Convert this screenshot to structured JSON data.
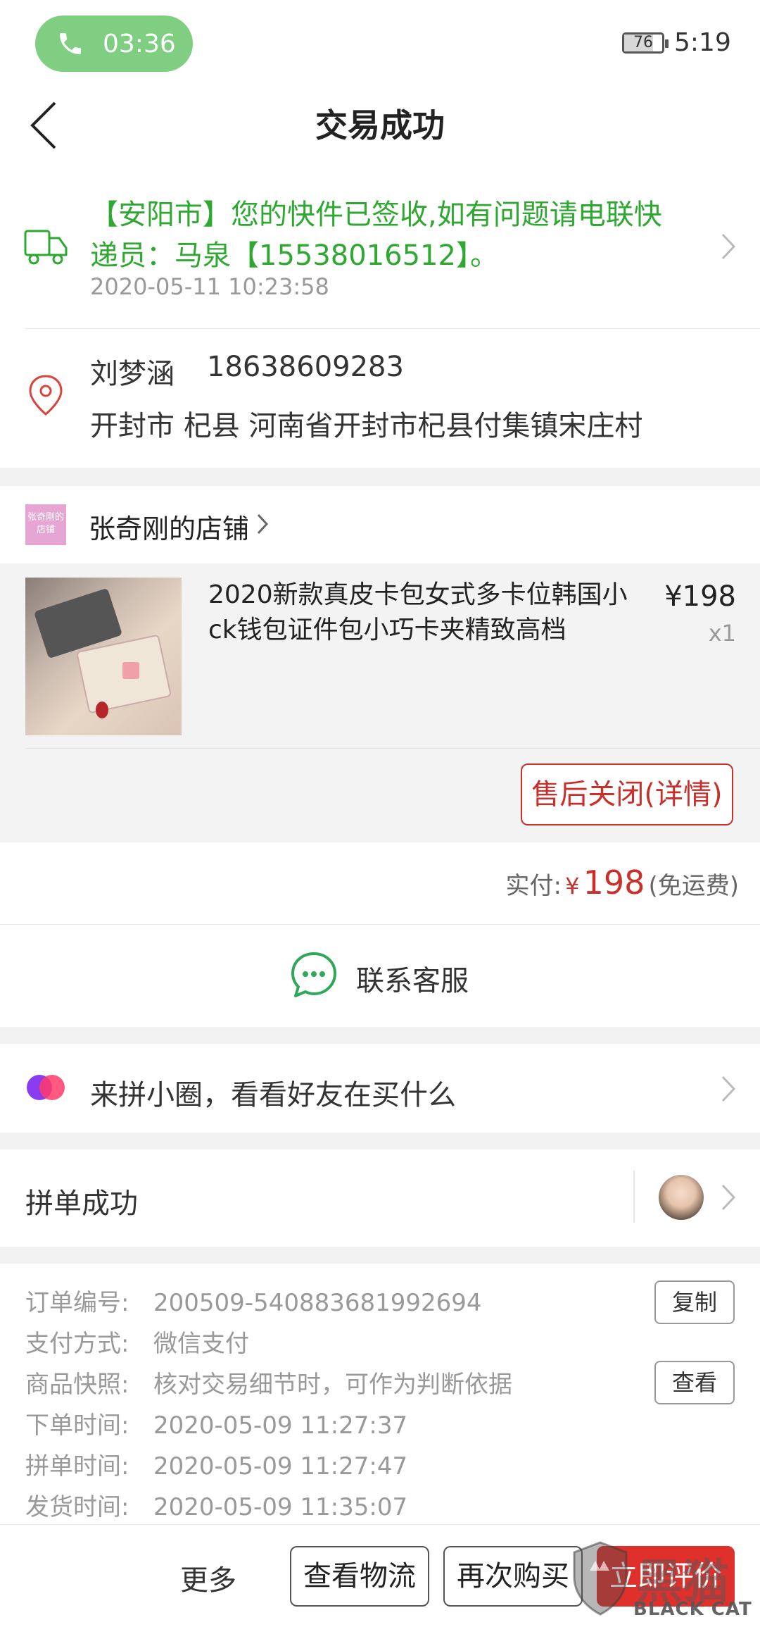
{
  "status_bar": {
    "call_time": "03:36",
    "battery": "76",
    "battery_level_percent": 76,
    "clock": "5:19"
  },
  "nav": {
    "title": "交易成功"
  },
  "logistics": {
    "line1": "【安阳市】您的快件已签收,如有问题请电联快",
    "line2": "递员：马泉【15538016512】。",
    "time": "2020-05-11 10:23:58"
  },
  "address": {
    "name": "刘梦涵",
    "phone": "18638609283",
    "detail": "开封市 杞县 河南省开封市杞县付集镇宋庄村"
  },
  "shop": {
    "logo_text_1": "张奇刚的",
    "logo_text_2": "店铺",
    "name": "张奇刚的店铺"
  },
  "product": {
    "title_line1": "2020新款真皮卡包女式多卡位韩国小",
    "title_line2": "ck钱包证件包小巧卡夹精致高档",
    "price": "¥198",
    "qty": "x1",
    "after_sale_label": "售后关闭(详情)"
  },
  "payment": {
    "label": "实付:",
    "currency": "¥",
    "amount": "198",
    "shipping": "(免运费)"
  },
  "contact": {
    "label": "联系客服"
  },
  "circle": {
    "label": "来拼小圈，看看好友在买什么"
  },
  "group": {
    "label": "拼单成功"
  },
  "order_info": {
    "rows": [
      {
        "key": "订单编号:",
        "value": "200509-540883681992694"
      },
      {
        "key": "支付方式:",
        "value": "微信支付"
      },
      {
        "key": "商品快照:",
        "value": "核对交易细节时，可作为判断依据"
      },
      {
        "key": "下单时间:",
        "value": "2020-05-09 11:27:37"
      },
      {
        "key": "拼单时间:",
        "value": "2020-05-09 11:27:47"
      },
      {
        "key": "发货时间:",
        "value": "2020-05-09 11:35:07"
      }
    ],
    "copy_label": "复制",
    "view_label": "查看"
  },
  "bottom_bar": {
    "more_label": "更多",
    "logistics_label": "查看物流",
    "rebuy_label": "再次购买",
    "review_label": "立即评价"
  },
  "watermark": {
    "big_text": "黑猫",
    "small_text": "BLACK CAT"
  },
  "colors": {
    "accent_red": "#c9302c",
    "logistics_green": "#2fa832",
    "call_pill_green": "#7fce82",
    "chat_icon_green": "#2fa85a"
  }
}
